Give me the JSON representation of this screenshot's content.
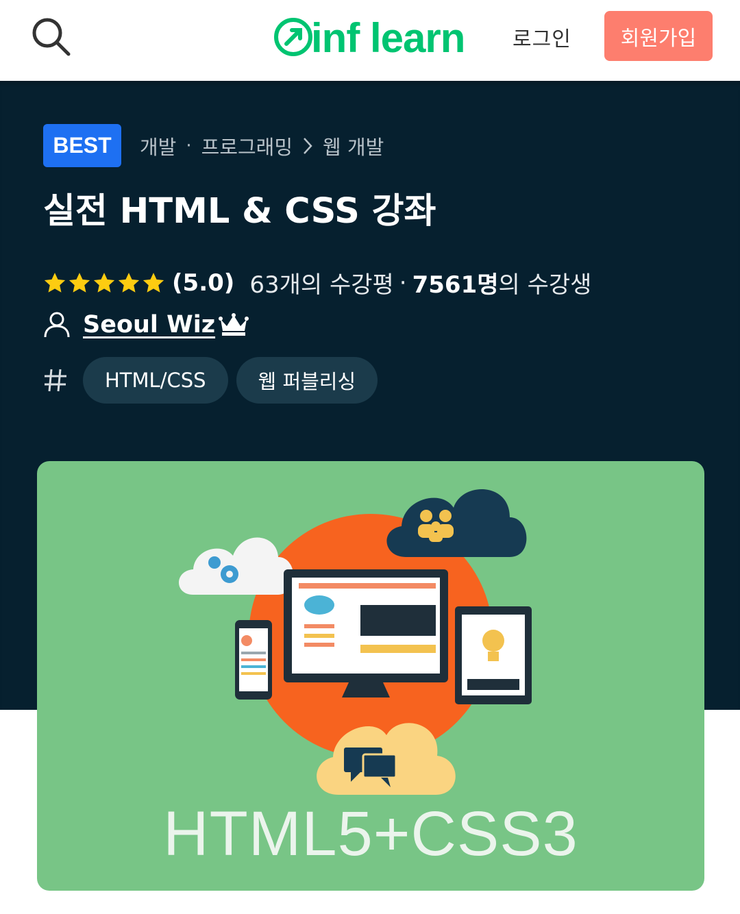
{
  "header": {
    "logo_text": "inf learn",
    "login_label": "로그인",
    "signup_label": "회원가입",
    "brand_color": "#00c471",
    "signup_color": "#fd7e6e"
  },
  "hero": {
    "badge": "BEST",
    "breadcrumb": {
      "category": "개발",
      "subcategory": "프로그래밍",
      "separator": "·",
      "current": "웹 개발"
    },
    "title": "실전 HTML & CSS 강좌",
    "rating": {
      "stars": 5,
      "score": "(5.0)",
      "reviews": "63개의 수강평",
      "separator": "·",
      "students_count": "7561명",
      "students_suffix": "의 수강생"
    },
    "author": "Seoul Wiz",
    "tags": [
      "HTML/CSS",
      "웹 퍼블리싱"
    ]
  },
  "thumbnail": {
    "label": "HTML5+CSS3",
    "bg_color": "#78c586",
    "accent_color": "#f7631f"
  }
}
